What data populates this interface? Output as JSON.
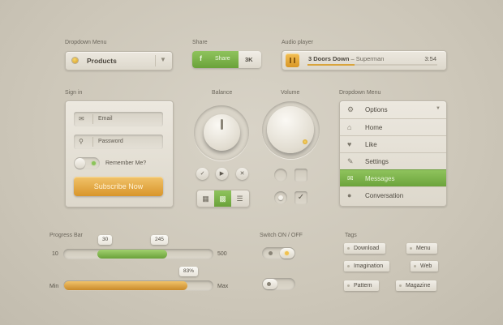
{
  "dropdown_closed": {
    "caption": "Dropdown Menu",
    "selected": "Products"
  },
  "share": {
    "caption": "Share",
    "icon": "f",
    "label": "Share",
    "count": "3K",
    "accent": "#7ab24a"
  },
  "audio": {
    "caption": "Audio player",
    "artist": "3 Doors Down",
    "separator": " – ",
    "song": "Superman",
    "time": "3:54",
    "progress": 0.36
  },
  "signin": {
    "caption": "Sign in",
    "email_placeholder": "Email",
    "password_placeholder": "Password",
    "remember_label": "Remember Me?",
    "submit_label": "Subscribe Now"
  },
  "balance": {
    "caption": "Balance"
  },
  "volume": {
    "caption": "Volume"
  },
  "dropdown_open": {
    "caption": "Dropdown Menu",
    "items": [
      {
        "label": "Options",
        "icon": "gear-icon",
        "glyph": "⚙"
      },
      {
        "label": "Home",
        "icon": "home-icon",
        "glyph": "⌂"
      },
      {
        "label": "Like",
        "icon": "heart-icon",
        "glyph": "♥"
      },
      {
        "label": "Settings",
        "icon": "wrench-icon",
        "glyph": "✎"
      },
      {
        "label": "Messages",
        "icon": "envelope-icon",
        "glyph": "✉"
      },
      {
        "label": "Conversation",
        "icon": "speech-bubble-icon",
        "glyph": "●"
      }
    ],
    "active_item": "Messages"
  },
  "progress": {
    "caption": "Progress Bar",
    "range_min": "10",
    "range_max": "500",
    "range_low_value": "30",
    "range_high_value": "245",
    "single_min_label": "Min",
    "single_max_label": "Max",
    "single_value": "83%",
    "single_fraction": 0.83
  },
  "switch": {
    "caption": "Switch ON / OFF"
  },
  "tags": {
    "caption": "Tags",
    "items": [
      "Download",
      "Menu",
      "Imagination",
      "Web",
      "Pattern",
      "Magazine"
    ]
  }
}
